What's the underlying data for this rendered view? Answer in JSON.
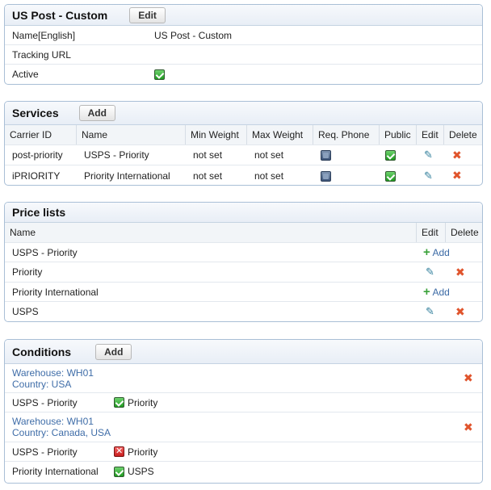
{
  "carrier": {
    "title": "US Post - Custom",
    "edit_label": "Edit",
    "fields": [
      {
        "label": "Name[English]",
        "value": "US Post - Custom"
      },
      {
        "label": "Tracking URL",
        "value": ""
      },
      {
        "label": "Active",
        "checked": true
      }
    ]
  },
  "services": {
    "title": "Services",
    "add_label": "Add",
    "columns": [
      "Carrier ID",
      "Name",
      "Min Weight",
      "Max Weight",
      "Req. Phone",
      "Public",
      "Edit",
      "Delete"
    ],
    "rows": [
      {
        "carrier_id": "post-priority",
        "name": "USPS - Priority",
        "min_weight": "not set",
        "max_weight": "not set",
        "req_phone": false,
        "public": true
      },
      {
        "carrier_id": "iPRIORITY",
        "name": "Priority International",
        "min_weight": "not set",
        "max_weight": "not set",
        "req_phone": false,
        "public": true
      }
    ]
  },
  "price_lists": {
    "title": "Price lists",
    "columns": [
      "Name",
      "Edit",
      "Delete"
    ],
    "add_label": "Add",
    "rows": [
      {
        "name": "USPS - Priority",
        "action": "add"
      },
      {
        "name": "Priority",
        "action": "edit"
      },
      {
        "name": "Priority International",
        "action": "add"
      },
      {
        "name": "USPS",
        "action": "edit"
      }
    ]
  },
  "conditions": {
    "title": "Conditions",
    "add_label": "Add",
    "groups": [
      {
        "warehouse": "Warehouse: WH01",
        "country": "Country: USA",
        "items": [
          {
            "service": "USPS - Priority",
            "status": "on",
            "label": "Priority"
          }
        ]
      },
      {
        "warehouse": "Warehouse: WH01",
        "country": "Country: Canada, USA",
        "items": [
          {
            "service": "USPS - Priority",
            "status": "x",
            "label": "Priority"
          },
          {
            "service": "Priority International",
            "status": "on",
            "label": "USPS"
          }
        ]
      }
    ]
  },
  "colors": {
    "panel_border": "#a9bfd6",
    "link": "#3f6da8",
    "delete": "#e0542c",
    "add": "#3aa23a"
  }
}
